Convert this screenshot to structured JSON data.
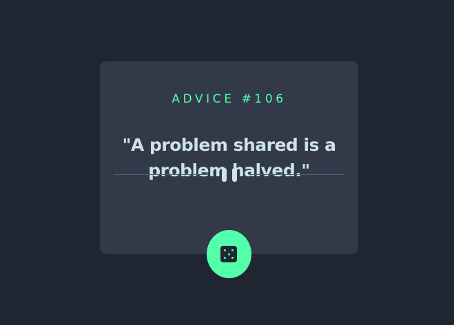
{
  "advice": {
    "id_label": "ADVICE #106",
    "quote": "\"A problem shared is a problem halved.\""
  },
  "button": {
    "aria_label": "Get new advice",
    "icon": "dice-icon"
  },
  "colors": {
    "background": "#1f2631",
    "card": "#323a49",
    "accent": "#53ffaa",
    "text": "#cee3e9",
    "divider": "#4f5d74"
  }
}
